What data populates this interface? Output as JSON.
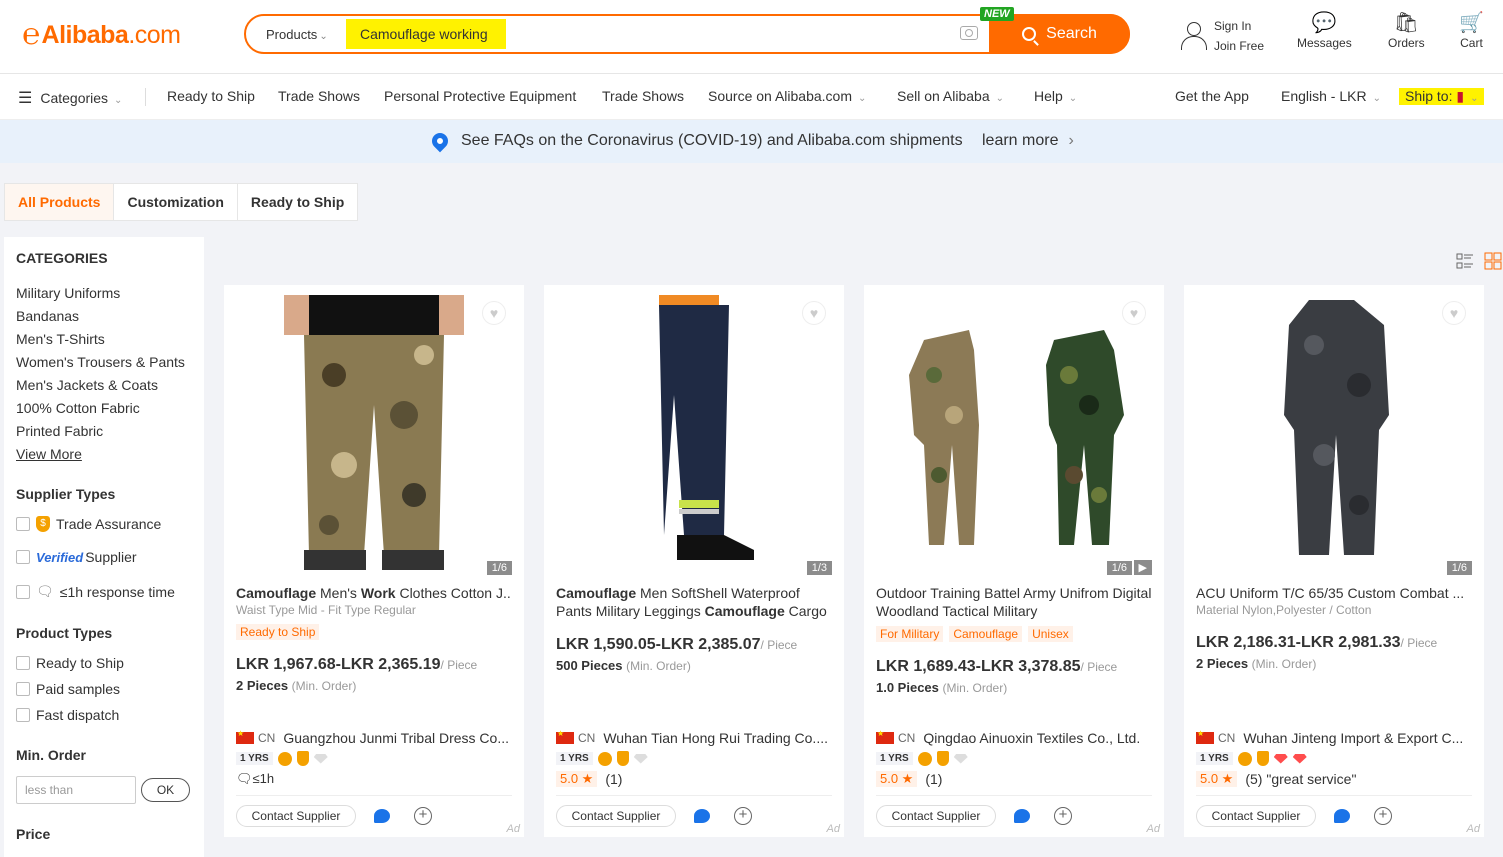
{
  "header": {
    "logo_mark": "℮",
    "logo_brand": "Alibaba",
    "logo_domain": ".com",
    "search_category": "Products",
    "search_query": "Camouflage working",
    "new_badge": "NEW",
    "search_button": "Search",
    "sign_in": "Sign In",
    "join_free": "Join Free",
    "messages": "Messages",
    "orders": "Orders",
    "cart": "Cart"
  },
  "nav": {
    "categories": "Categories",
    "items": [
      "Ready to Ship",
      "Trade Shows",
      "Personal Protective Equipment",
      "Trade Shows",
      "Source on Alibaba.com",
      "Sell on Alibaba",
      "Help"
    ],
    "get_app": "Get the App",
    "language": "English - LKR",
    "ship_to": "Ship to:"
  },
  "banner": {
    "message": "See FAQs on the Coronavirus (COVID-19) and Alibaba.com shipments",
    "link": "learn more"
  },
  "tabs": [
    "All Products",
    "Customization",
    "Ready to Ship"
  ],
  "sidebar": {
    "categories_title": "CATEGORIES",
    "categories": [
      "Military Uniforms",
      "Bandanas",
      "Men's T-Shirts",
      "Women's Trousers & Pants",
      "Men's Jackets & Coats",
      "100% Cotton Fabric",
      "Printed Fabric"
    ],
    "view_more": "View More",
    "supplier_types_title": "Supplier Types",
    "trade_assurance": "Trade Assurance",
    "verified": "Verified",
    "supplier": "Supplier",
    "response_time": "≤1h response time",
    "product_types_title": "Product Types",
    "product_types": [
      "Ready to Ship",
      "Paid samples",
      "Fast dispatch"
    ],
    "min_order_title": "Min. Order",
    "min_order_placeholder": "less than",
    "ok": "OK",
    "price_title": "Price"
  },
  "products": [
    {
      "title_parts": [
        "Camouflage",
        " Men's ",
        "Work",
        " Clothes Cotton J..."
      ],
      "subtitle": "Waist Type Mid - Fit Type Regular",
      "tags": [
        "Ready to Ship"
      ],
      "price": "LKR 1,967.68-LKR 2,365.19",
      "unit": "/ Piece",
      "moq": "2 Pieces",
      "moq_label": "(Min. Order)",
      "image_count": "1/6",
      "country": "CN",
      "supplier": "Guangzhou Junmi Tribal Dress Co...",
      "years": "1 YRS",
      "response": "≤1h",
      "contact": "Contact Supplier",
      "ad": "Ad"
    },
    {
      "title_line1": "Camouflage Men SoftShell Waterproof",
      "title_parts": [
        "Camouflage",
        " Men SoftShell Waterproof Pants Military Leggings ",
        "Camouflage",
        " Cargo"
      ],
      "price": "LKR 1,590.05-LKR 2,385.07",
      "unit": "/ Piece",
      "moq": "500 Pieces",
      "moq_label": "(Min. Order)",
      "image_count": "1/3",
      "country": "CN",
      "supplier": "Wuhan Tian Hong Rui Trading Co....",
      "years": "1 YRS",
      "score": "5.0 ★",
      "reviews": "(1)",
      "contact": "Contact Supplier",
      "ad": "Ad"
    },
    {
      "title": "Outdoor Training Battel Army Unifrom Digital Woodland Tactical Military",
      "tags": [
        "For Military",
        "Camouflage",
        "Unisex"
      ],
      "price": "LKR 1,689.43-LKR 3,378.85",
      "unit": "/ Piece",
      "moq": "1.0 Pieces",
      "moq_label": "(Min. Order)",
      "image_count": "1/6",
      "play": "▶",
      "country": "CN",
      "supplier": "Qingdao Ainuoxin Textiles Co., Ltd.",
      "years": "1 YRS",
      "score": "5.0 ★",
      "reviews": "(1)",
      "contact": "Contact Supplier",
      "ad": "Ad"
    },
    {
      "title": "ACU Uniform T/C 65/35 Custom Combat ...",
      "subtitle": "Material Nylon,Polyester / Cotton",
      "price": "LKR 2,186.31-LKR 2,981.33",
      "unit": "/ Piece",
      "moq": "2 Pieces",
      "moq_label": "(Min. Order)",
      "image_count": "1/6",
      "country": "CN",
      "supplier": "Wuhan Jinteng Import & Export C...",
      "years": "1 YRS",
      "score": "5.0 ★",
      "reviews": "(5) \"great service\"",
      "contact": "Contact Supplier",
      "ad": "Ad"
    }
  ],
  "colors": {
    "brand": "#ff6a00",
    "highlight": "#fff200",
    "banner_bg": "#e8f1fb"
  }
}
